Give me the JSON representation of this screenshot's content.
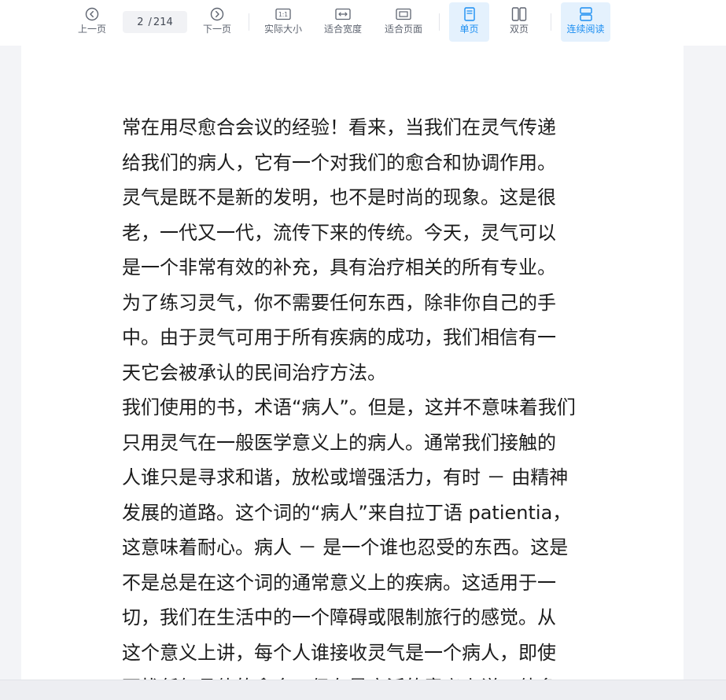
{
  "toolbar": {
    "prev_label": "上一页",
    "page_current": "2",
    "page_separator": "/",
    "page_total": "214",
    "next_label": "下一页",
    "actual_size_label": "实际大小",
    "actual_size_glyph": "1:1",
    "fit_width_label": "适合宽度",
    "fit_page_label": "适合页面",
    "single_page_label": "单页",
    "double_page_label": "双页",
    "continuous_label": "连续阅读",
    "active_color": "#1b8ef2",
    "icon_color": "#5e6470"
  },
  "document": {
    "lines": [
      "常在用尽愈合会议的经验！看来，当我们在灵气传递",
      "给我们的病人，它有一个对我们的愈合和协调作用。",
      "灵气是既不是新的发明，也不是时尚的现象。这是很",
      "老，一代又一代，流传下来的传统。今天，灵气可以",
      "是一个非常有效的补充，具有治疗相关的所有专业。",
      "为了练习灵气，你不需要任何东西，除非你自己的手",
      "中。由于灵气可用于所有疾病的成功，我们相信有一",
      "天它会被承认的民间治疗方法。",
      "我们使用的书，术语“病人”。但是，这并不意味着我们",
      "只用灵气在一般医学意义上的病人。通常我们接触的",
      "人谁只是寻求和谐，放松或增强活力，有时 － 由精神",
      "发展的道路。这个词的“病人”来自拉丁语 patientia，",
      "这意味着耐心。病人 － 是一个谁也忍受的东西。这是",
      "不是总是在这个词的通常意义上的疾病。这适用于一",
      "切，我们在生活中的一个障碍或限制旅行的感觉。从",
      "这个意义上讲，每个人谁接收灵气是一个病人，即使",
      "不找任何具体的愈合，但在最广泛的意义上说，他多"
    ]
  }
}
